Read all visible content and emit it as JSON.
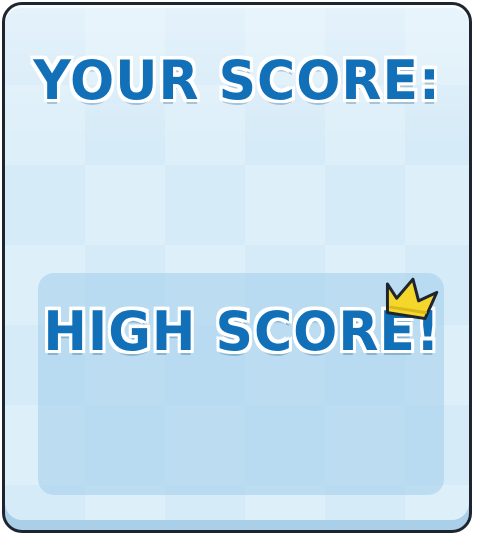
{
  "score_panel": {
    "title": "YOUR SCORE:",
    "high_score_label": "HIGH SCORE!"
  },
  "icons": {
    "crown": "crown-icon"
  },
  "colors": {
    "panel_bg": "#d6ebf8",
    "panel_border": "#1e2530",
    "title_text": "#1270b8",
    "crown": "#f4d72a",
    "highscore_box": "#b5d8ef"
  }
}
